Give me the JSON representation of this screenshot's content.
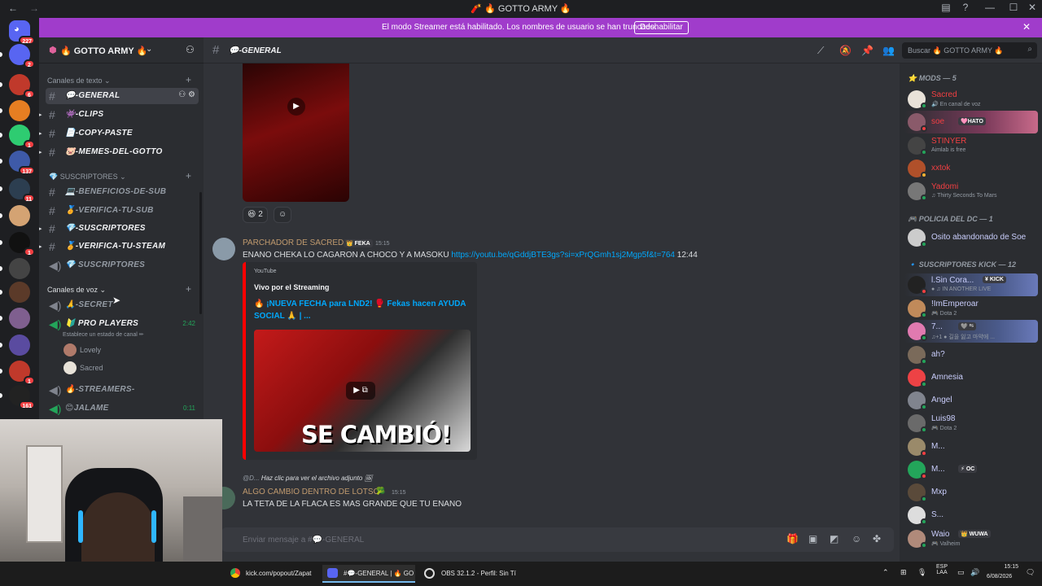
{
  "window": {
    "title": "🧨 🔥 GOTTO ARMY 🔥",
    "back_icon": "←",
    "forward_icon": "→",
    "inbox_icon": "▤",
    "help_icon": "?",
    "min_icon": "—",
    "max_icon": "☐",
    "close_icon": "✕"
  },
  "rail": {
    "home_badge": "227",
    "servers": [
      {
        "badge": "2",
        "color": "#5865f2"
      },
      {
        "badge": "6",
        "color": "#c0392b"
      },
      {
        "badge": "",
        "color": "#e67e22"
      },
      {
        "badge": "1",
        "color": "#2ecc71"
      },
      {
        "badge": "137",
        "color": "#3e5aa8"
      },
      {
        "badge": "11",
        "color": "#2c3e50"
      },
      {
        "badge": "",
        "color": "#d4a373"
      },
      {
        "badge": "1",
        "color": "#111111"
      },
      {
        "badge": "",
        "color": "#444444"
      },
      {
        "badge": "",
        "color": "#5b3a29"
      },
      {
        "badge": "",
        "color": "#7f5f8f"
      },
      {
        "badge": "",
        "color": "#5a4ba0"
      },
      {
        "badge": "1",
        "color": "#c0392b"
      },
      {
        "badge": "161",
        "color": "#222222"
      }
    ]
  },
  "banner": {
    "text": "El modo Streamer está habilitado. Los nombres de usuario se han truncado.",
    "button": "Deshabilitar",
    "close_icon": "✕"
  },
  "sidebar": {
    "server_name": "🔥 GOTTO ARMY 🔥",
    "chevron": "⌄",
    "invite_icon": "👤+",
    "categories": {
      "text": "Canales de texto",
      "subs": "SUSCRIPTORES",
      "voice": "Canales de voz"
    },
    "text_channels": [
      {
        "name": "💬-GENERAL"
      },
      {
        "name": "👾-CLIPS"
      },
      {
        "name": "📄-COPY-PASTE"
      },
      {
        "name": "🐷-MEMES-DEL-GOTTO"
      }
    ],
    "sub_channels": [
      {
        "name": "💻-BENEFICIOS-DE-SUB"
      },
      {
        "name": "🏅-VERIFICA-TU-SUB"
      },
      {
        "name": "💎-SUSCRIPTORES"
      },
      {
        "name": "🏅-VERIFICA-TU-STEAM"
      },
      {
        "name": "💎 SUSCRIPTORES"
      }
    ],
    "voice_channels": [
      {
        "name": "🙏-SECRET",
        "time": ""
      },
      {
        "name": "🔰 PRO PLAYERS",
        "time": "2:42"
      },
      {
        "name": "🔥-STREAMERS-",
        "time": ""
      },
      {
        "name": "😊JALAME",
        "time": "0:11"
      }
    ],
    "voice_status": "Establece un estado de canal ✏",
    "voice_users": [
      {
        "name": "Lovely"
      },
      {
        "name": "Sacred"
      }
    ]
  },
  "header": {
    "channel": "💬-GENERAL",
    "search_placeholder": "Buscar 🔥 GOTTO ARMY 🔥",
    "search_icon": "⌕"
  },
  "chat": {
    "reactions": [
      {
        "emoji": "😆",
        "count": "2"
      },
      {
        "emoji": "☺",
        "count": ""
      }
    ],
    "msg1": {
      "author": "PARCHADOR DE SACRED",
      "tag": "👑 FEKA",
      "time": "15:15",
      "text": "ENANO CHEKA LO CAGARON A CHOCO Y A MASOKU",
      "link": "https://youtu.be/qGddjBTE3gs?si=xPrQGmh1sj2Mgp5f&t=764",
      "after": "12:44"
    },
    "embed": {
      "provider": "YouTube",
      "title": "Vivo por el Streaming",
      "video_title": "🔥 ¡NUEVA FECHA para LND2! 🥊 Fekas hacen AYUDA SOCIAL 🙏 | ...",
      "thumb_text": "SE CAMBIÓ!"
    },
    "reply": {
      "user": "@D...",
      "text": "Haz clic para ver el archivo adjunto 🖼"
    },
    "msg2": {
      "author": "ALGO CAMBIO DENTRO DE LOTSO",
      "tag": "🥦",
      "time": "15:15",
      "text": "LA TETA DE LA FLACA ES MAS GRANDE QUE TU ENANO"
    },
    "composer_placeholder": "Enviar mensaje a #💬-GENERAL"
  },
  "members": {
    "groups": [
      {
        "title": "⭐ MODS — 5"
      },
      {
        "title": "🎮 POLICIA DEL DC — 1"
      },
      {
        "title": "🔹 SUSCRIPTORES KICK — 12"
      }
    ],
    "list": [
      {
        "name": "Sacred",
        "sub": "🔊 En canal de voz",
        "color": "#f23f42",
        "chip": "",
        "status": "#23a55a"
      },
      {
        "name": "soe",
        "sub": "",
        "color": "#f23f42",
        "chip": "🩷HATO",
        "status": "#f23f42"
      },
      {
        "name": "STINYER",
        "sub": "Aimlab is free",
        "color": "#f23f42",
        "chip": "",
        "status": "#23a55a"
      },
      {
        "name": "xxtok",
        "sub": "",
        "color": "#f23f42",
        "chip": "",
        "status": "#f0b232"
      },
      {
        "name": "Yadomi",
        "sub": "♫ Thirty Seconds To Mars",
        "color": "#f23f42",
        "chip": "",
        "status": "#23a55a"
      },
      {
        "name": "Osito abandonado de Soe",
        "sub": "",
        "color": "#c9cdfb",
        "chip": "",
        "status": "#23a55a"
      },
      {
        "name": "l.Sin Cora...",
        "sub": "● ♫ IN ANOTHER LIVE",
        "color": "#c9cdfb",
        "chip": "¥ KICK",
        "status": "#f23f42"
      },
      {
        "name": "!ImEmperoar",
        "sub": "🎮 Dota 2",
        "color": "#c9cdfb",
        "chip": "",
        "status": "#23a55a"
      },
      {
        "name": "7...",
        "sub": "♫+1 ● 길을 잃고 마약에 ...",
        "color": "#c9cdfb",
        "chip": "🩶 ²⁵",
        "status": "#23a55a"
      },
      {
        "name": "ah?",
        "sub": "",
        "color": "#c9cdfb",
        "chip": "",
        "status": "#23a55a"
      },
      {
        "name": "Amnesia",
        "sub": "",
        "color": "#c9cdfb",
        "chip": "",
        "status": "#23a55a"
      },
      {
        "name": "Angel",
        "sub": "",
        "color": "#c9cdfb",
        "chip": "",
        "status": "#23a55a"
      },
      {
        "name": "Luis98",
        "sub": "🎮 Dota 2",
        "color": "#c9cdfb",
        "chip": "",
        "status": "#23a55a"
      },
      {
        "name": "M...",
        "sub": "",
        "color": "#c9cdfb",
        "chip": "",
        "status": "#f23f42"
      },
      {
        "name": "M...",
        "sub": "",
        "color": "#c9cdfb",
        "chip": "⚡ OC",
        "status": "#f23f42"
      },
      {
        "name": "Mxp",
        "sub": "",
        "color": "#c9cdfb",
        "chip": "",
        "status": "#23a55a"
      },
      {
        "name": "S...",
        "sub": "",
        "color": "#c9cdfb",
        "chip": "",
        "status": "#23a55a"
      },
      {
        "name": "Waio",
        "sub": "🎮 Valheim",
        "color": "#c9cdfb",
        "chip": "👑 WUWA",
        "status": "#23a55a"
      }
    ]
  },
  "taskbar": {
    "tasks": [
      {
        "label": "kick.com/popout/Zapat"
      },
      {
        "label": "#💬-GENERAL | 🔥 GO"
      },
      {
        "label": "OBS 32.1.2 - Perfil: Sin Tí"
      }
    ],
    "lang": "ESP",
    "lang2": "LAA",
    "time": "15:15",
    "date": "6/08/2026"
  }
}
